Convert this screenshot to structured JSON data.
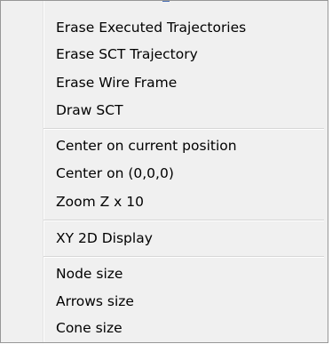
{
  "context_menu": {
    "groups": [
      {
        "items": [
          {
            "label": "Erase Executed Trajectories"
          },
          {
            "label": "Erase SCT Trajectory"
          },
          {
            "label": "Erase Wire Frame"
          },
          {
            "label": "Draw  SCT"
          }
        ]
      },
      {
        "items": [
          {
            "label": "Center on current position"
          },
          {
            "label": "Center on (0,0,0)"
          },
          {
            "label": "Zoom Z x 10"
          }
        ]
      },
      {
        "items": [
          {
            "label": "XY 2D Display"
          }
        ]
      },
      {
        "items": [
          {
            "label": "Node size"
          },
          {
            "label": "Arrows size"
          },
          {
            "label": "Cone size"
          }
        ]
      }
    ]
  }
}
